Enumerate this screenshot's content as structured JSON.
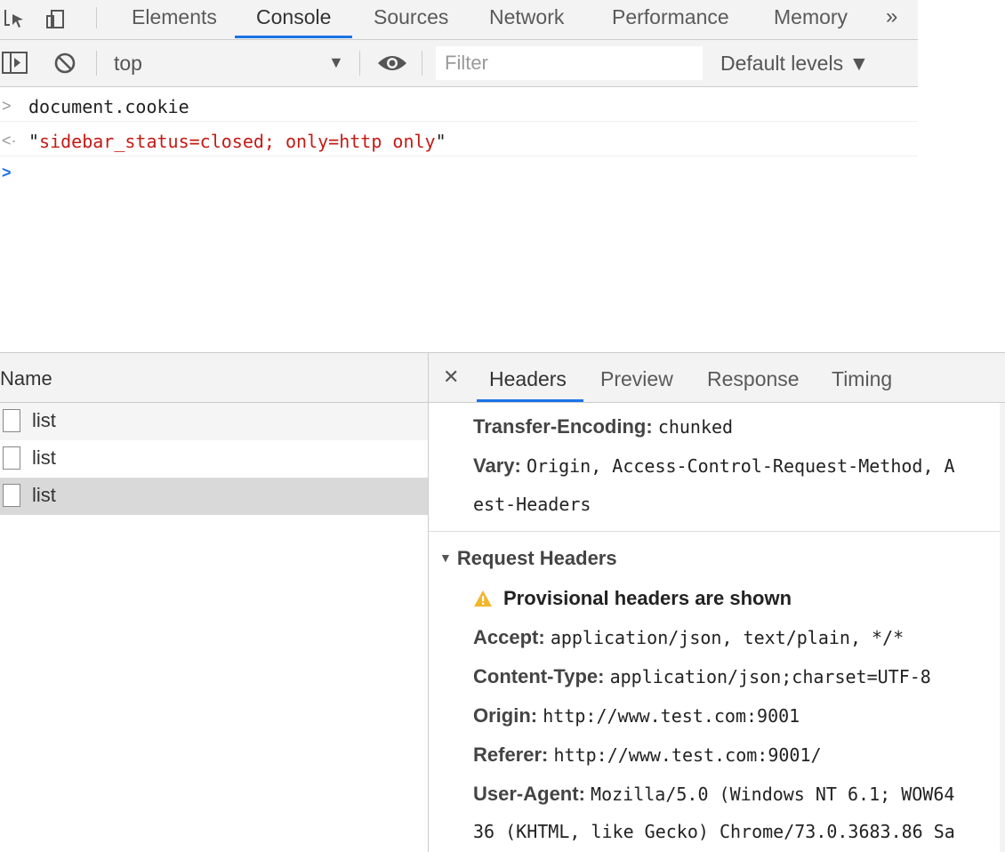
{
  "devtools": {
    "tabs": [
      {
        "label": "Elements"
      },
      {
        "label": "Console"
      },
      {
        "label": "Sources"
      },
      {
        "label": "Network"
      },
      {
        "label": "Performance"
      },
      {
        "label": "Memory"
      }
    ],
    "more_tabs": "»",
    "active_tab": "Console"
  },
  "console_toolbar": {
    "context": "top",
    "filter_placeholder": "Filter",
    "levels": "Default levels ▼"
  },
  "console": {
    "input": "document.cookie",
    "output_quote_open": "\"",
    "output_value": "sidebar_status=closed; only=http only",
    "output_quote_close": "\""
  },
  "network": {
    "name_header": "Name",
    "requests": [
      {
        "label": "list"
      },
      {
        "label": "list"
      },
      {
        "label": "list"
      }
    ],
    "selected_index": 2,
    "detail_tabs": [
      {
        "label": "Headers"
      },
      {
        "label": "Preview"
      },
      {
        "label": "Response"
      },
      {
        "label": "Timing"
      }
    ],
    "active_detail_tab": "Headers",
    "response_headers": [
      {
        "key": "Transfer-Encoding:",
        "value": "chunked"
      },
      {
        "key": "Vary:",
        "value": "Origin, Access-Control-Request-Method, A"
      }
    ],
    "vary_continuation": "est-Headers",
    "request_section_title": "Request Headers",
    "provisional_warning": "Provisional headers are shown",
    "request_headers": [
      {
        "key": "Accept:",
        "value": "application/json, text/plain, */*"
      },
      {
        "key": "Content-Type:",
        "value": "application/json;charset=UTF-8"
      },
      {
        "key": "Origin:",
        "value": "http://www.test.com:9001"
      },
      {
        "key": "Referer:",
        "value": "http://www.test.com:9001/"
      },
      {
        "key": "User-Agent:",
        "value": "Mozilla/5.0 (Windows NT 6.1; WOW64"
      }
    ],
    "user_agent_continuation": "36 (KHTML, like Gecko) Chrome/73.0.3683.86 Sa"
  },
  "colors": {
    "accent": "#1a73e8",
    "string": "#c41a16",
    "toolbar_bg": "#f3f3f3",
    "selected_row": "#d9d9d9",
    "warning": "#f1b62a"
  },
  "icons": [
    "inspect-element-icon",
    "device-toolbar-icon",
    "sidebar-toggle-icon",
    "clear-console-icon",
    "eye-icon",
    "dropdown-arrow-icon",
    "close-icon",
    "file-icon",
    "warning-icon",
    "triangle-down-icon"
  ]
}
